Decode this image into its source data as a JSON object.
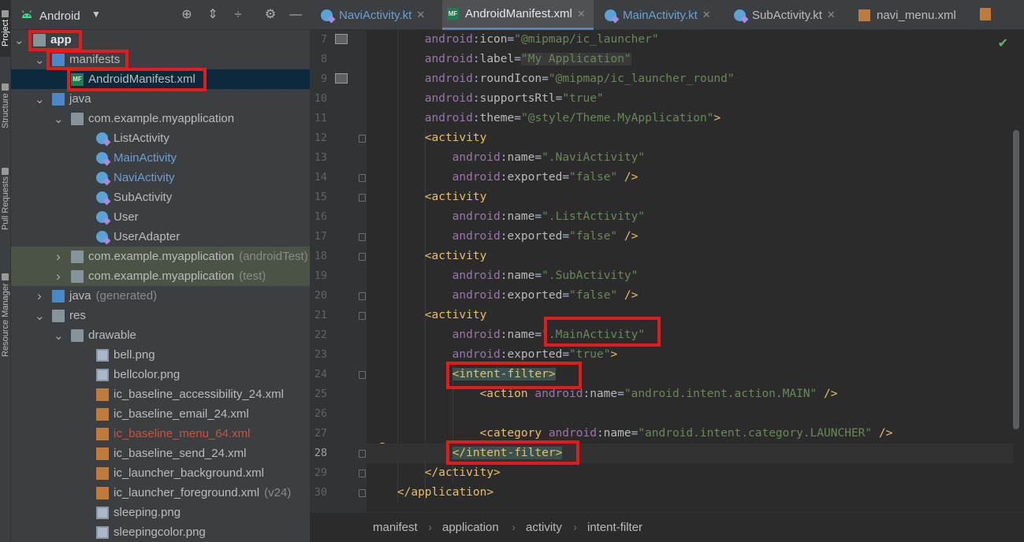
{
  "side_tabs": [
    "Project",
    "Structure",
    "Pull Requests",
    "Resource Manager"
  ],
  "project_panel": {
    "view_mode": "Android",
    "toolbar_icons": [
      "target-icon",
      "expand-all-icon",
      "collapse-all-icon",
      "settings-icon",
      "minimize-icon"
    ],
    "tree": [
      {
        "label": "app",
        "indent": 0,
        "expanded": true,
        "icon": "module-folder",
        "bold": true
      },
      {
        "label": "manifests",
        "indent": 1,
        "expanded": true,
        "icon": "folder"
      },
      {
        "label": "AndroidManifest.xml",
        "indent": 2,
        "icon": "manifest-file",
        "selected": true
      },
      {
        "label": "java",
        "indent": 1,
        "expanded": true,
        "icon": "folder"
      },
      {
        "label": "com.example.myapplication",
        "indent": 2,
        "expanded": true,
        "icon": "package"
      },
      {
        "label": "ListActivity",
        "indent": 3,
        "icon": "kotlin-class"
      },
      {
        "label": "MainActivity",
        "indent": 3,
        "icon": "kotlin-class",
        "style": "blue"
      },
      {
        "label": "NaviActivity",
        "indent": 3,
        "icon": "kotlin-class",
        "style": "blue"
      },
      {
        "label": "SubActivity",
        "indent": 3,
        "icon": "kotlin-class"
      },
      {
        "label": "User",
        "indent": 3,
        "icon": "kotlin-class"
      },
      {
        "label": "UserAdapter",
        "indent": 3,
        "icon": "kotlin-class"
      },
      {
        "label": "com.example.myapplication",
        "suffix": "(androidTest)",
        "indent": 2,
        "expanded": false,
        "icon": "package",
        "highlight": true
      },
      {
        "label": "com.example.myapplication",
        "suffix": "(test)",
        "indent": 2,
        "expanded": false,
        "icon": "package",
        "highlight": true
      },
      {
        "label": "java",
        "suffix": "(generated)",
        "indent": 1,
        "expanded": false,
        "icon": "generated-folder"
      },
      {
        "label": "res",
        "indent": 1,
        "expanded": true,
        "icon": "res-folder"
      },
      {
        "label": "drawable",
        "indent": 2,
        "expanded": true,
        "icon": "package"
      },
      {
        "label": "bell.png",
        "indent": 3,
        "icon": "image-file"
      },
      {
        "label": "bellcolor.png",
        "indent": 3,
        "icon": "image-file"
      },
      {
        "label": "ic_baseline_accessibility_24.xml",
        "indent": 3,
        "icon": "xml-file"
      },
      {
        "label": "ic_baseline_email_24.xml",
        "indent": 3,
        "icon": "xml-file"
      },
      {
        "label": "ic_baseline_menu_64.xml",
        "indent": 3,
        "icon": "xml-file",
        "style": "red"
      },
      {
        "label": "ic_baseline_send_24.xml",
        "indent": 3,
        "icon": "xml-file"
      },
      {
        "label": "ic_launcher_background.xml",
        "indent": 3,
        "icon": "xml-file"
      },
      {
        "label": "ic_launcher_foreground.xml",
        "suffix": "(v24)",
        "indent": 3,
        "icon": "xml-file"
      },
      {
        "label": "sleeping.png",
        "indent": 3,
        "icon": "image-file"
      },
      {
        "label": "sleepingcolor.png",
        "indent": 3,
        "icon": "image-file"
      }
    ]
  },
  "editor_tabs": [
    {
      "label": "NaviActivity.kt",
      "icon": "kotlin-class",
      "active": false
    },
    {
      "label": "AndroidManifest.xml",
      "icon": "manifest-file",
      "active": true
    },
    {
      "label": "MainActivity.kt",
      "icon": "kotlin-class",
      "active": false
    },
    {
      "label": "SubActivity.kt",
      "icon": "kotlin-class",
      "active": false
    },
    {
      "label": "navi_menu.xml",
      "icon": "xml-file",
      "active": false
    }
  ],
  "editor": {
    "current_line": 28,
    "lines": [
      {
        "n": 7,
        "indent": 8,
        "tokens": [
          [
            "ns",
            "android"
          ],
          [
            "plain",
            ":"
          ],
          [
            "attr",
            "icon"
          ],
          [
            "plain",
            "="
          ],
          [
            "val",
            "\"@mipmap/ic_launcher\""
          ]
        ],
        "gutter_icon": "image"
      },
      {
        "n": 8,
        "indent": 8,
        "tokens": [
          [
            "ns",
            "android"
          ],
          [
            "plain",
            ":"
          ],
          [
            "attr",
            "label"
          ],
          [
            "plain",
            "="
          ],
          [
            "val-hl",
            "\"My Application\""
          ]
        ]
      },
      {
        "n": 9,
        "indent": 8,
        "tokens": [
          [
            "ns",
            "android"
          ],
          [
            "plain",
            ":"
          ],
          [
            "attr",
            "roundIcon"
          ],
          [
            "plain",
            "="
          ],
          [
            "val",
            "\"@mipmap/ic_launcher_round\""
          ]
        ],
        "gutter_icon": "image"
      },
      {
        "n": 10,
        "indent": 8,
        "tokens": [
          [
            "ns",
            "android"
          ],
          [
            "plain",
            ":"
          ],
          [
            "attr",
            "supportsRtl"
          ],
          [
            "plain",
            "="
          ],
          [
            "val",
            "\"true\""
          ]
        ]
      },
      {
        "n": 11,
        "indent": 8,
        "tokens": [
          [
            "ns",
            "android"
          ],
          [
            "plain",
            ":"
          ],
          [
            "attr",
            "theme"
          ],
          [
            "plain",
            "="
          ],
          [
            "val",
            "\"@style/Theme.MyApplication\""
          ],
          [
            "tag",
            ">"
          ]
        ]
      },
      {
        "n": 12,
        "indent": 8,
        "tokens": [
          [
            "tag",
            "<activity"
          ]
        ],
        "fold": true
      },
      {
        "n": 13,
        "indent": 12,
        "tokens": [
          [
            "ns",
            "android"
          ],
          [
            "plain",
            ":"
          ],
          [
            "attr",
            "name"
          ],
          [
            "plain",
            "="
          ],
          [
            "val",
            "\".NaviActivity\""
          ]
        ]
      },
      {
        "n": 14,
        "indent": 12,
        "tokens": [
          [
            "ns",
            "android"
          ],
          [
            "plain",
            ":"
          ],
          [
            "attr",
            "exported"
          ],
          [
            "plain",
            "="
          ],
          [
            "val",
            "\"false\""
          ],
          [
            "plain",
            " "
          ],
          [
            "tag",
            "/>"
          ]
        ],
        "fold": true
      },
      {
        "n": 15,
        "indent": 8,
        "tokens": [
          [
            "tag",
            "<activity"
          ]
        ],
        "fold": true
      },
      {
        "n": 16,
        "indent": 12,
        "tokens": [
          [
            "ns",
            "android"
          ],
          [
            "plain",
            ":"
          ],
          [
            "attr",
            "name"
          ],
          [
            "plain",
            "="
          ],
          [
            "val",
            "\".ListActivity\""
          ]
        ]
      },
      {
        "n": 17,
        "indent": 12,
        "tokens": [
          [
            "ns",
            "android"
          ],
          [
            "plain",
            ":"
          ],
          [
            "attr",
            "exported"
          ],
          [
            "plain",
            "="
          ],
          [
            "val",
            "\"false\""
          ],
          [
            "plain",
            " "
          ],
          [
            "tag",
            "/>"
          ]
        ],
        "fold": true
      },
      {
        "n": 18,
        "indent": 8,
        "tokens": [
          [
            "tag",
            "<activity"
          ]
        ],
        "fold": true
      },
      {
        "n": 19,
        "indent": 12,
        "tokens": [
          [
            "ns",
            "android"
          ],
          [
            "plain",
            ":"
          ],
          [
            "attr",
            "name"
          ],
          [
            "plain",
            "="
          ],
          [
            "val",
            "\".SubActivity\""
          ]
        ]
      },
      {
        "n": 20,
        "indent": 12,
        "tokens": [
          [
            "ns",
            "android"
          ],
          [
            "plain",
            ":"
          ],
          [
            "attr",
            "exported"
          ],
          [
            "plain",
            "="
          ],
          [
            "val",
            "\"false\""
          ],
          [
            "plain",
            " "
          ],
          [
            "tag",
            "/>"
          ]
        ],
        "fold": true
      },
      {
        "n": 21,
        "indent": 8,
        "tokens": [
          [
            "tag",
            "<activity"
          ]
        ],
        "fold": true
      },
      {
        "n": 22,
        "indent": 12,
        "tokens": [
          [
            "ns",
            "android"
          ],
          [
            "plain",
            ":"
          ],
          [
            "attr",
            "name"
          ],
          [
            "plain",
            "="
          ],
          [
            "val",
            "\".MainActivity\""
          ]
        ]
      },
      {
        "n": 23,
        "indent": 12,
        "tokens": [
          [
            "ns",
            "android"
          ],
          [
            "plain",
            ":"
          ],
          [
            "attr",
            "exported"
          ],
          [
            "plain",
            "="
          ],
          [
            "val",
            "\"true\""
          ],
          [
            "tag",
            ">"
          ]
        ]
      },
      {
        "n": 24,
        "indent": 12,
        "tokens": [
          [
            "tag-hl",
            "<intent-filter>"
          ]
        ],
        "fold": true
      },
      {
        "n": 25,
        "indent": 16,
        "tokens": [
          [
            "tag",
            "<action "
          ],
          [
            "ns",
            "android"
          ],
          [
            "plain",
            ":"
          ],
          [
            "attr",
            "name"
          ],
          [
            "plain",
            "="
          ],
          [
            "val",
            "\"android.intent.action.MAIN\""
          ],
          [
            "plain",
            " "
          ],
          [
            "tag",
            "/>"
          ]
        ]
      },
      {
        "n": 26,
        "indent": 0,
        "tokens": []
      },
      {
        "n": 27,
        "indent": 16,
        "tokens": [
          [
            "tag",
            "<category "
          ],
          [
            "ns",
            "android"
          ],
          [
            "plain",
            ":"
          ],
          [
            "attr",
            "name"
          ],
          [
            "plain",
            "="
          ],
          [
            "val",
            "\"android.intent.category.LAUNCHER\""
          ],
          [
            "plain",
            " "
          ],
          [
            "tag",
            "/>"
          ]
        ]
      },
      {
        "n": 28,
        "indent": 12,
        "tokens": [
          [
            "tag-hl",
            "</intent-filter>"
          ]
        ],
        "fold": true
      },
      {
        "n": 29,
        "indent": 8,
        "tokens": [
          [
            "tag",
            "</activity>"
          ]
        ],
        "fold": true
      },
      {
        "n": 30,
        "indent": 4,
        "tokens": [
          [
            "tag",
            "</application>"
          ]
        ],
        "fold": true
      }
    ]
  },
  "breadcrumbs": [
    "manifest",
    "application",
    "activity",
    "intent-filter"
  ],
  "colors": {
    "highlight_box": "#e31b1b",
    "accent": "#4a88c7"
  }
}
